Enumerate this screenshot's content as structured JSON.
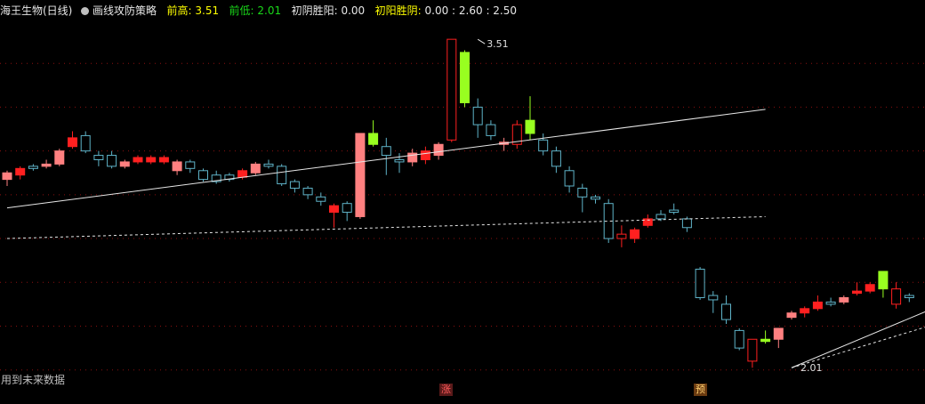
{
  "header": {
    "stock_name": "海王生物(日线)",
    "indicator_name": "画线攻防策略",
    "prev_high_label": "前高:",
    "prev_high_value": "3.51",
    "prev_low_label": "前低:",
    "prev_low_value": "2.01",
    "yin_label": "初阴胜阳:",
    "yin_value": "0.00",
    "yang_label": "初阳胜阴:",
    "yang_value": "0.00 : 2.60 : 2.50"
  },
  "note": "用到未来数据",
  "markers": {
    "rise": "涨",
    "pre": "预"
  },
  "colors": {
    "background": "#000000",
    "up_red": "#ff2020",
    "up_pink": "#ff8080",
    "down_cyan": "#5fb3c8",
    "signal_green": "#98ff20",
    "grid_red": "#8b1010",
    "line_white": "#e6e6e6",
    "dash_cyan": "#3a8a9a"
  },
  "chart_data": {
    "type": "candlestick",
    "ylim": [
      1.95,
      3.6
    ],
    "x_count": 70,
    "grid": "dotted-horizontal",
    "candles": [
      {
        "o": 2.87,
        "h": 2.91,
        "l": 2.84,
        "c": 2.9,
        "k": "pink"
      },
      {
        "o": 2.89,
        "h": 2.93,
        "l": 2.87,
        "c": 2.92,
        "k": "red"
      },
      {
        "o": 2.92,
        "h": 2.94,
        "l": 2.91,
        "c": 2.93,
        "k": "cyan"
      },
      {
        "o": 2.93,
        "h": 2.96,
        "l": 2.92,
        "c": 2.94,
        "k": "pink"
      },
      {
        "o": 2.94,
        "h": 3.01,
        "l": 2.93,
        "c": 3.0,
        "k": "pink"
      },
      {
        "o": 3.02,
        "h": 3.09,
        "l": 3.01,
        "c": 3.06,
        "k": "red"
      },
      {
        "o": 3.07,
        "h": 3.09,
        "l": 2.99,
        "c": 3.0,
        "k": "cyan"
      },
      {
        "o": 2.98,
        "h": 3.0,
        "l": 2.93,
        "c": 2.96,
        "k": "cyan"
      },
      {
        "o": 2.98,
        "h": 3.0,
        "l": 2.92,
        "c": 2.93,
        "k": "cyan"
      },
      {
        "o": 2.93,
        "h": 2.96,
        "l": 2.92,
        "c": 2.95,
        "k": "pink"
      },
      {
        "o": 2.95,
        "h": 2.98,
        "l": 2.94,
        "c": 2.97,
        "k": "red"
      },
      {
        "o": 2.95,
        "h": 2.98,
        "l": 2.94,
        "c": 2.97,
        "k": "red"
      },
      {
        "o": 2.97,
        "h": 2.98,
        "l": 2.94,
        "c": 2.95,
        "k": "red"
      },
      {
        "o": 2.91,
        "h": 2.96,
        "l": 2.89,
        "c": 2.95,
        "k": "pink"
      },
      {
        "o": 2.95,
        "h": 2.96,
        "l": 2.9,
        "c": 2.92,
        "k": "cyan"
      },
      {
        "o": 2.91,
        "h": 2.92,
        "l": 2.86,
        "c": 2.87,
        "k": "cyan"
      },
      {
        "o": 2.86,
        "h": 2.91,
        "l": 2.85,
        "c": 2.89,
        "k": "cyan"
      },
      {
        "o": 2.89,
        "h": 2.9,
        "l": 2.86,
        "c": 2.87,
        "k": "cyan"
      },
      {
        "o": 2.88,
        "h": 2.92,
        "l": 2.87,
        "c": 2.91,
        "k": "red"
      },
      {
        "o": 2.9,
        "h": 2.95,
        "l": 2.89,
        "c": 2.94,
        "k": "pink"
      },
      {
        "o": 2.94,
        "h": 2.96,
        "l": 2.92,
        "c": 2.93,
        "k": "cyan"
      },
      {
        "o": 2.93,
        "h": 2.94,
        "l": 2.84,
        "c": 2.85,
        "k": "cyan"
      },
      {
        "o": 2.86,
        "h": 2.87,
        "l": 2.81,
        "c": 2.83,
        "k": "cyan"
      },
      {
        "o": 2.83,
        "h": 2.84,
        "l": 2.78,
        "c": 2.8,
        "k": "cyan"
      },
      {
        "o": 2.79,
        "h": 2.81,
        "l": 2.75,
        "c": 2.77,
        "k": "cyan"
      },
      {
        "o": 2.72,
        "h": 2.76,
        "l": 2.65,
        "c": 2.75,
        "k": "red"
      },
      {
        "o": 2.72,
        "h": 2.77,
        "l": 2.68,
        "c": 2.76,
        "k": "cyan"
      },
      {
        "o": 2.7,
        "h": 3.08,
        "l": 2.69,
        "c": 3.08,
        "k": "pink"
      },
      {
        "o": 3.08,
        "h": 3.14,
        "l": 3.02,
        "c": 3.03,
        "k": "green"
      },
      {
        "o": 3.02,
        "h": 3.06,
        "l": 2.89,
        "c": 2.98,
        "k": "cyan"
      },
      {
        "o": 2.95,
        "h": 2.99,
        "l": 2.9,
        "c": 2.96,
        "k": "cyan"
      },
      {
        "o": 2.95,
        "h": 3.01,
        "l": 2.93,
        "c": 2.99,
        "k": "pink"
      },
      {
        "o": 2.96,
        "h": 3.02,
        "l": 2.94,
        "c": 3.0,
        "k": "red"
      },
      {
        "o": 2.98,
        "h": 3.04,
        "l": 2.96,
        "c": 3.03,
        "k": "pink"
      },
      {
        "o": 3.05,
        "h": 3.51,
        "l": 3.04,
        "c": 3.51,
        "k": "redhollow"
      },
      {
        "o": 3.45,
        "h": 3.46,
        "l": 3.2,
        "c": 3.22,
        "k": "green"
      },
      {
        "o": 3.2,
        "h": 3.24,
        "l": 3.06,
        "c": 3.12,
        "k": "cyan"
      },
      {
        "o": 3.12,
        "h": 3.14,
        "l": 3.05,
        "c": 3.07,
        "k": "cyan"
      },
      {
        "o": 3.04,
        "h": 3.06,
        "l": 3.0,
        "c": 3.03,
        "k": "pink"
      },
      {
        "o": 3.03,
        "h": 3.14,
        "l": 3.01,
        "c": 3.12,
        "k": "redhollow"
      },
      {
        "o": 3.14,
        "h": 3.25,
        "l": 3.05,
        "c": 3.08,
        "k": "green"
      },
      {
        "o": 3.05,
        "h": 3.08,
        "l": 2.98,
        "c": 3.0,
        "k": "cyan"
      },
      {
        "o": 3.0,
        "h": 3.02,
        "l": 2.9,
        "c": 2.93,
        "k": "cyan"
      },
      {
        "o": 2.91,
        "h": 2.93,
        "l": 2.81,
        "c": 2.84,
        "k": "cyan"
      },
      {
        "o": 2.83,
        "h": 2.85,
        "l": 2.72,
        "c": 2.79,
        "k": "cyan"
      },
      {
        "o": 2.79,
        "h": 2.8,
        "l": 2.76,
        "c": 2.78,
        "k": "cyan"
      },
      {
        "o": 2.76,
        "h": 2.78,
        "l": 2.58,
        "c": 2.6,
        "k": "cyan"
      },
      {
        "o": 2.62,
        "h": 2.66,
        "l": 2.56,
        "c": 2.6,
        "k": "redhollow"
      },
      {
        "o": 2.6,
        "h": 2.65,
        "l": 2.58,
        "c": 2.64,
        "k": "red"
      },
      {
        "o": 2.66,
        "h": 2.71,
        "l": 2.65,
        "c": 2.69,
        "k": "red"
      },
      {
        "o": 2.69,
        "h": 2.73,
        "l": 2.68,
        "c": 2.71,
        "k": "cyan"
      },
      {
        "o": 2.73,
        "h": 2.76,
        "l": 2.71,
        "c": 2.72,
        "k": "cyan"
      },
      {
        "o": 2.69,
        "h": 2.7,
        "l": 2.63,
        "c": 2.65,
        "k": "cyan"
      },
      {
        "o": 2.46,
        "h": 2.47,
        "l": 2.32,
        "c": 2.33,
        "k": "cyan"
      },
      {
        "o": 2.32,
        "h": 2.36,
        "l": 2.26,
        "c": 2.34,
        "k": "cyan"
      },
      {
        "o": 2.3,
        "h": 2.34,
        "l": 2.21,
        "c": 2.23,
        "k": "cyan"
      },
      {
        "o": 2.18,
        "h": 2.19,
        "l": 2.09,
        "c": 2.1,
        "k": "cyan"
      },
      {
        "o": 2.04,
        "h": 2.14,
        "l": 2.01,
        "c": 2.14,
        "k": "redhollow"
      },
      {
        "o": 2.13,
        "h": 2.18,
        "l": 2.12,
        "c": 2.14,
        "k": "green"
      },
      {
        "o": 2.14,
        "h": 2.19,
        "l": 2.1,
        "c": 2.19,
        "k": "pink"
      },
      {
        "o": 2.24,
        "h": 2.27,
        "l": 2.23,
        "c": 2.26,
        "k": "pink"
      },
      {
        "o": 2.26,
        "h": 2.29,
        "l": 2.24,
        "c": 2.28,
        "k": "red"
      },
      {
        "o": 2.28,
        "h": 2.34,
        "l": 2.27,
        "c": 2.31,
        "k": "red"
      },
      {
        "o": 2.3,
        "h": 2.33,
        "l": 2.29,
        "c": 2.31,
        "k": "cyan"
      },
      {
        "o": 2.31,
        "h": 2.34,
        "l": 2.3,
        "c": 2.33,
        "k": "pink"
      },
      {
        "o": 2.35,
        "h": 2.4,
        "l": 2.34,
        "c": 2.36,
        "k": "red"
      },
      {
        "o": 2.36,
        "h": 2.4,
        "l": 2.35,
        "c": 2.39,
        "k": "red"
      },
      {
        "o": 2.37,
        "h": 2.45,
        "l": 2.33,
        "c": 2.45,
        "k": "green"
      },
      {
        "o": 2.37,
        "h": 2.4,
        "l": 2.28,
        "c": 2.3,
        "k": "redhollow"
      },
      {
        "o": 2.33,
        "h": 2.35,
        "l": 2.31,
        "c": 2.34,
        "k": "cyan"
      }
    ],
    "lines": [
      {
        "style": "solid",
        "points": [
          [
            0,
            2.74
          ],
          [
            58,
            3.19
          ]
        ]
      },
      {
        "style": "dashed",
        "points": [
          [
            0,
            2.6
          ],
          [
            58,
            2.7
          ]
        ]
      },
      {
        "style": "solid",
        "points": [
          [
            60,
            2.01
          ],
          [
            74,
            2.36
          ]
        ]
      },
      {
        "style": "dashed",
        "points": [
          [
            60,
            2.01
          ],
          [
            76,
            2.3
          ]
        ]
      }
    ],
    "gridlines": [
      3.4,
      3.2,
      3.0,
      2.8,
      2.6,
      2.4,
      2.2,
      2.0
    ],
    "annotations": [
      {
        "x": 36,
        "y": 3.51,
        "text": "3.51"
      },
      {
        "x": 60,
        "y": 2.01,
        "text": "2.01"
      }
    ]
  }
}
